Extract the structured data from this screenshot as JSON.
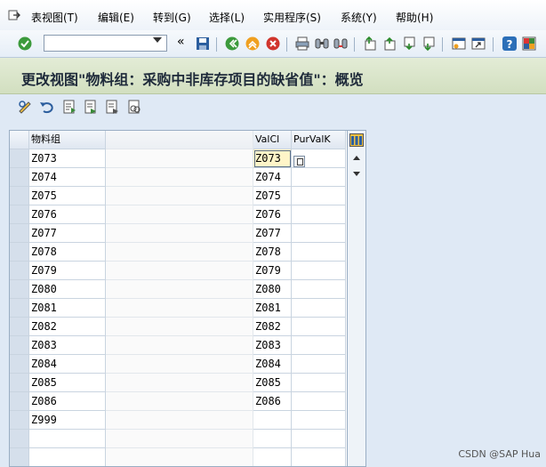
{
  "menu": {
    "items": [
      {
        "label": "表视图(T)"
      },
      {
        "label": "编辑(E)"
      },
      {
        "label": "转到(G)"
      },
      {
        "label": "选择(L)"
      },
      {
        "label": "实用程序(S)"
      },
      {
        "label": "系统(Y)"
      },
      {
        "label": "帮助(H)"
      }
    ]
  },
  "toolbar": {
    "command_value": "",
    "back_chevron": "«"
  },
  "title": "更改视图\"物料组：采购中非库存项目的缺省值\"：概览",
  "table": {
    "headers": {
      "group": "物料组",
      "desc": "",
      "valcl": "ValCl",
      "purvalk": "PurValK"
    },
    "rows": [
      {
        "group": "Z073",
        "valcl": "Z073"
      },
      {
        "group": "Z074",
        "valcl": "Z074"
      },
      {
        "group": "Z075",
        "valcl": "Z075"
      },
      {
        "group": "Z076",
        "valcl": "Z076"
      },
      {
        "group": "Z077",
        "valcl": "Z077"
      },
      {
        "group": "Z078",
        "valcl": "Z078"
      },
      {
        "group": "Z079",
        "valcl": "Z079"
      },
      {
        "group": "Z080",
        "valcl": "Z080"
      },
      {
        "group": "Z081",
        "valcl": "Z081"
      },
      {
        "group": "Z082",
        "valcl": "Z082"
      },
      {
        "group": "Z083",
        "valcl": "Z083"
      },
      {
        "group": "Z084",
        "valcl": "Z084"
      },
      {
        "group": "Z085",
        "valcl": "Z085"
      },
      {
        "group": "Z086",
        "valcl": "Z086"
      },
      {
        "group": "Z999",
        "valcl": ""
      }
    ]
  },
  "watermark": "CSDN @SAP Hua",
  "colors": {
    "title_bg": "#d2dfc0",
    "body_bg": "#dfe9f5",
    "selected_cell": "#fff5c8"
  }
}
